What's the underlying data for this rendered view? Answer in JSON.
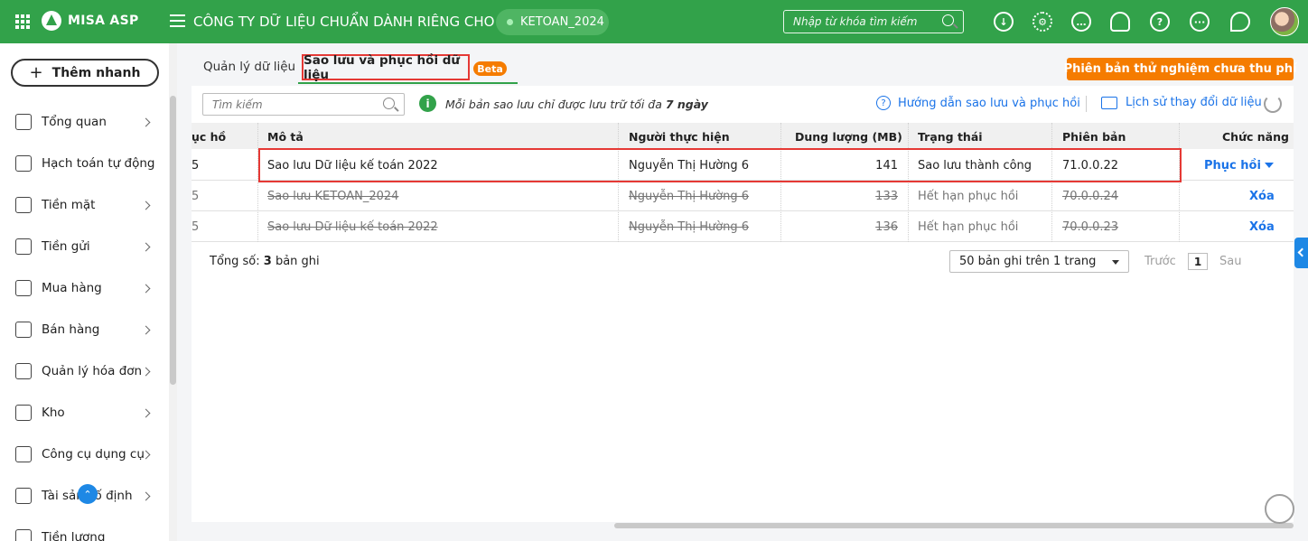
{
  "header": {
    "logo_text": "MISA ASP",
    "company_name": "CÔNG TY DỮ LIỆU CHUẨN DÀNH RIÊNG CHO BA",
    "database": "KETOAN_2024",
    "search_placeholder": "Nhập từ khóa tìm kiếm",
    "icons": [
      "download-icon",
      "gear-icon",
      "chat-icon",
      "bell-icon",
      "help-icon",
      "more-icon",
      "location-icon"
    ]
  },
  "sidebar": {
    "quick_add_label": "Thêm nhanh",
    "items": [
      {
        "label": "Tổng quan",
        "icon": "dashboard-icon"
      },
      {
        "label": "Hạch toán tự động",
        "icon": "auto-accounting-icon"
      },
      {
        "label": "Tiền mặt",
        "icon": "cash-bag-icon"
      },
      {
        "label": "Tiền gửi",
        "icon": "bank-icon"
      },
      {
        "label": "Mua hàng",
        "icon": "shopping-bag-icon"
      },
      {
        "label": "Bán hàng",
        "icon": "cart-icon"
      },
      {
        "label": "Quản lý hóa đơn",
        "icon": "invoice-icon"
      },
      {
        "label": "Kho",
        "icon": "warehouse-icon"
      },
      {
        "label": "Công cụ dụng cụ",
        "icon": "tools-icon"
      },
      {
        "label": "Tài sản cố định",
        "icon": "asset-icon"
      },
      {
        "label": "Tiền lương",
        "icon": "salary-icon"
      }
    ]
  },
  "tabs": {
    "data_management": "Quản lý dữ liệu",
    "backup_restore": "Sao lưu và phục hồi dữ liệu",
    "beta_badge": "Beta"
  },
  "trial_button": "Phiên bản thử nghiệm chưa thu phí",
  "toolbar": {
    "search_placeholder": "Tìm kiếm",
    "info_text_prefix": "Mỗi bản sao lưu chỉ được lưu trữ tối đa ",
    "info_text_bold": "7 ngày",
    "help_link": "Hướng dẫn sao lưu và phục hồi",
    "history_link": "Lịch sử thay đổi dữ liệu"
  },
  "table": {
    "headers": [
      "ục hồi",
      "Mô tả",
      "Người thực hiện",
      "Dung lượng (MB)",
      "Trạng thái",
      "Phiên bản",
      "Chức năng"
    ],
    "rows": [
      {
        "col0": "5",
        "desc": "Sao lưu Dữ liệu kế toán 2022",
        "user": "Nguyễn Thị Hường 6",
        "size": "141",
        "status": "Sao lưu thành công",
        "version": "71.0.0.22",
        "action": "Phục hồi",
        "expired": false
      },
      {
        "col0": "5",
        "desc": "Sao lưu KETOAN_2024",
        "user": "Nguyễn Thị Hường 6",
        "size": "133",
        "status": "Hết hạn phục hồi",
        "version": "70.0.0.24",
        "action": "Xóa",
        "expired": true
      },
      {
        "col0": "5",
        "desc": "Sao lưu Dữ liệu kế toán 2022",
        "user": "Nguyễn Thị Hường 6",
        "size": "136",
        "status": "Hết hạn phục hồi",
        "version": "70.0.0.23",
        "action": "Xóa",
        "expired": true
      }
    ]
  },
  "footer": {
    "total_prefix": "Tổng số: ",
    "total_count": "3",
    "total_suffix": " bản ghi",
    "page_size": "50 bản ghi trên 1 trang",
    "prev": "Trước",
    "page": "1",
    "next": "Sau"
  }
}
